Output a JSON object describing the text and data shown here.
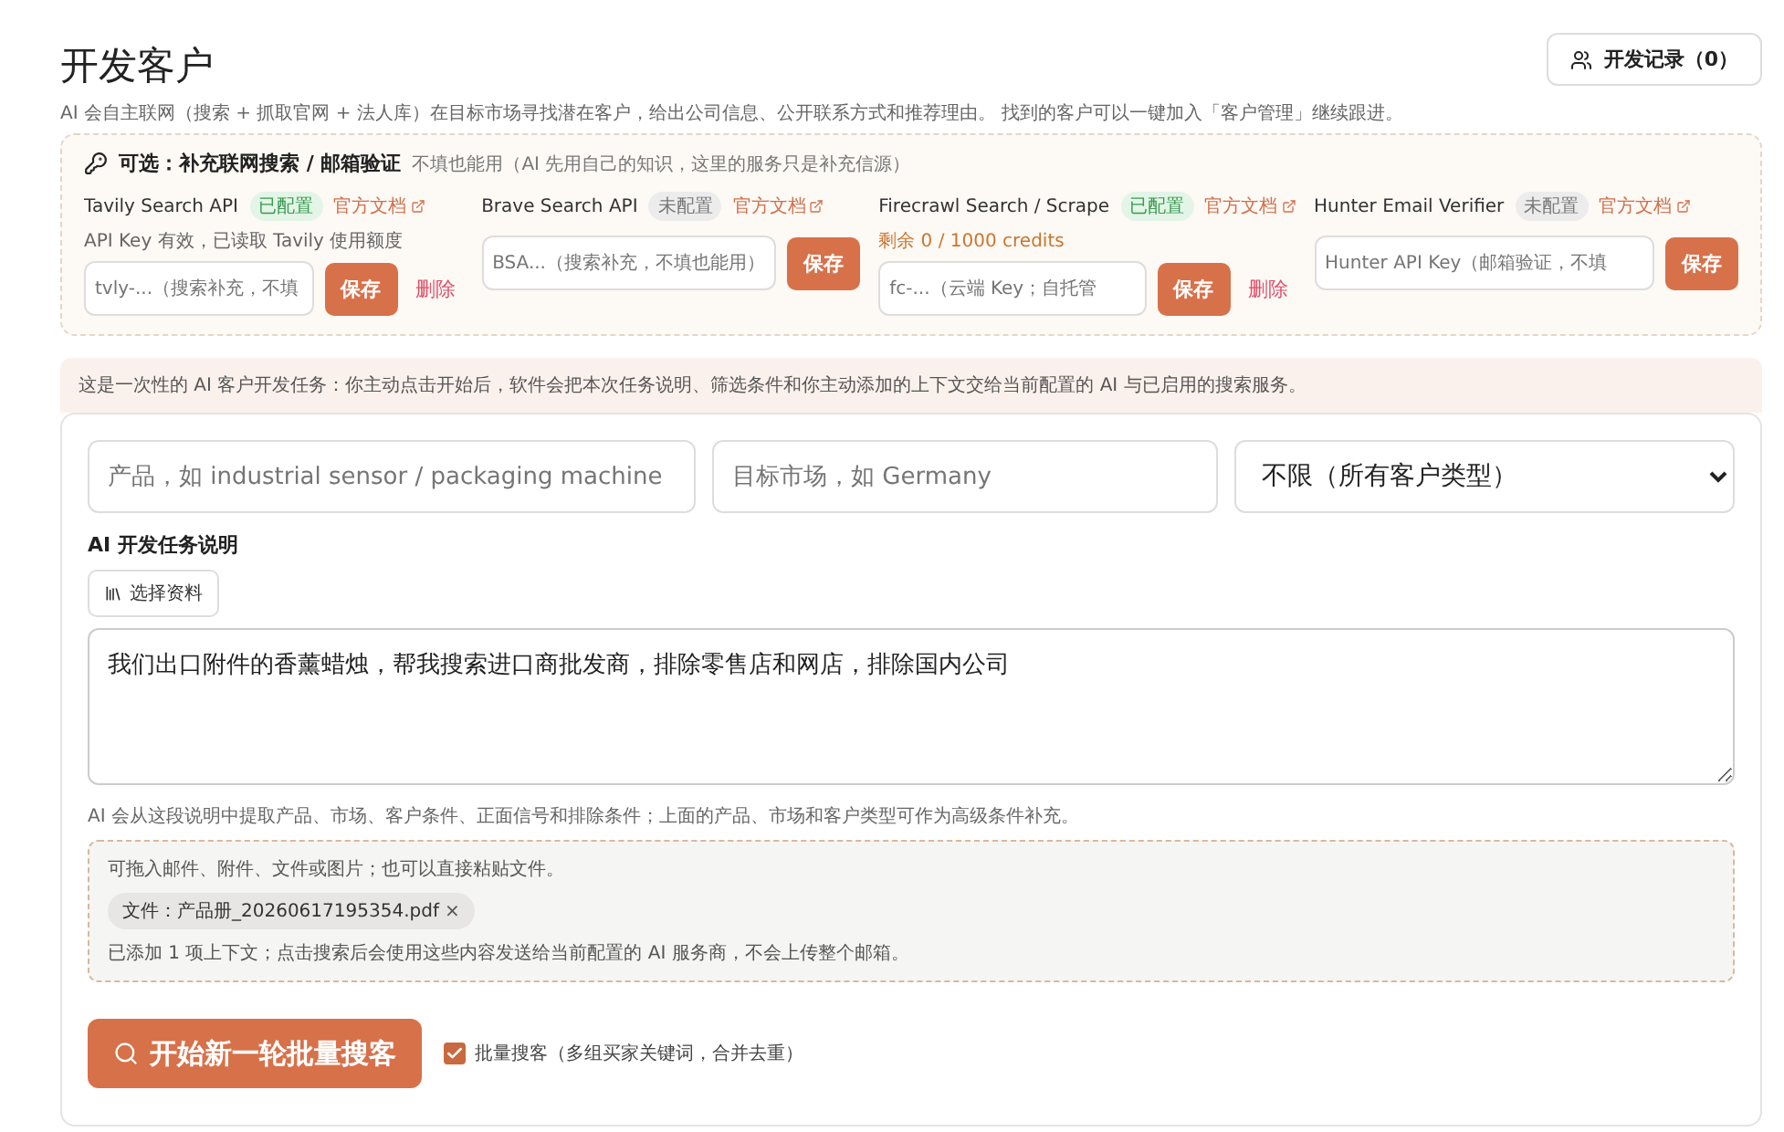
{
  "page": {
    "title": "开发客户",
    "description": "AI 会自主联网（搜索 + 抓取官网 + 法人库）在目标市场寻找潜在客户，给出公司信息、公开联系方式和推荐理由。 找到的客户可以一键加入「客户管理」继续跟进。",
    "history_button": "开发记录（0）"
  },
  "optional_panel": {
    "title": "可选：补充联网搜索 / 邮箱验证",
    "subtitle": "不填也能用（AI 先用自己的知识，这里的服务只是补充信源）",
    "services": [
      {
        "name": "Tavily Search API",
        "configured": true,
        "badge": "已配置",
        "doc_link": "官方文档",
        "note": "API Key 有效，已读取 Tavily 使用额度",
        "kind": "info",
        "placeholder": "tvly-...（搜索补充，不填",
        "save": "保存",
        "delete": "删除"
      },
      {
        "name": "Brave Search API",
        "configured": false,
        "badge": "未配置",
        "doc_link": "官方文档",
        "placeholder": "BSA...（搜索补充，不填也能用）",
        "save": "保存"
      },
      {
        "name": "Firecrawl Search / Scrape",
        "configured": true,
        "badge": "已配置",
        "doc_link": "官方文档",
        "note": "剩余 0 / 1000 credits",
        "kind": "warning",
        "placeholder": "fc-...（云端 Key；自托管",
        "save": "保存",
        "delete": "删除"
      },
      {
        "name": "Hunter Email Verifier",
        "configured": false,
        "badge": "未配置",
        "doc_link": "官方文档",
        "placeholder": "Hunter API Key（邮箱验证，不填",
        "save": "保存"
      }
    ]
  },
  "notice": "这是一次性的 AI 客户开发任务：你主动点击开始后，软件会把本次任务说明、筛选条件和你主动添加的上下文交给当前配置的 AI 与已启用的搜索服务。",
  "form": {
    "product_placeholder": "产品，如 industrial sensor / packaging machine",
    "market_placeholder": "目标市场，如 Germany",
    "customer_type": "不限（所有客户类型）",
    "task_label": "AI 开发任务说明",
    "choose_material": "选择资料",
    "task_text": "我们出口附件的香薰蜡烛，帮我搜索进口商批发商，排除零售店和网店，排除国内公司",
    "hint": "AI 会从这段说明中提取产品、市场、客户条件、正面信号和排除条件；上面的产品、市场和客户类型可作为高级条件补充。",
    "dropzone": {
      "hint": "可拖入邮件、附件、文件或图片；也可以直接粘贴文件。",
      "files": [
        {
          "label": "文件：产品册_20260617195354.pdf",
          "remove": "×"
        }
      ],
      "added_note": "已添加 1 项上下文；点击搜索后会使用这些内容发送给当前配置的 AI 服务商，不会上传整个邮箱。"
    },
    "search_button": "开始新一轮批量搜客",
    "batch": {
      "checked": true,
      "label": "批量搜客（多组买家关键词，合并去重）"
    }
  }
}
